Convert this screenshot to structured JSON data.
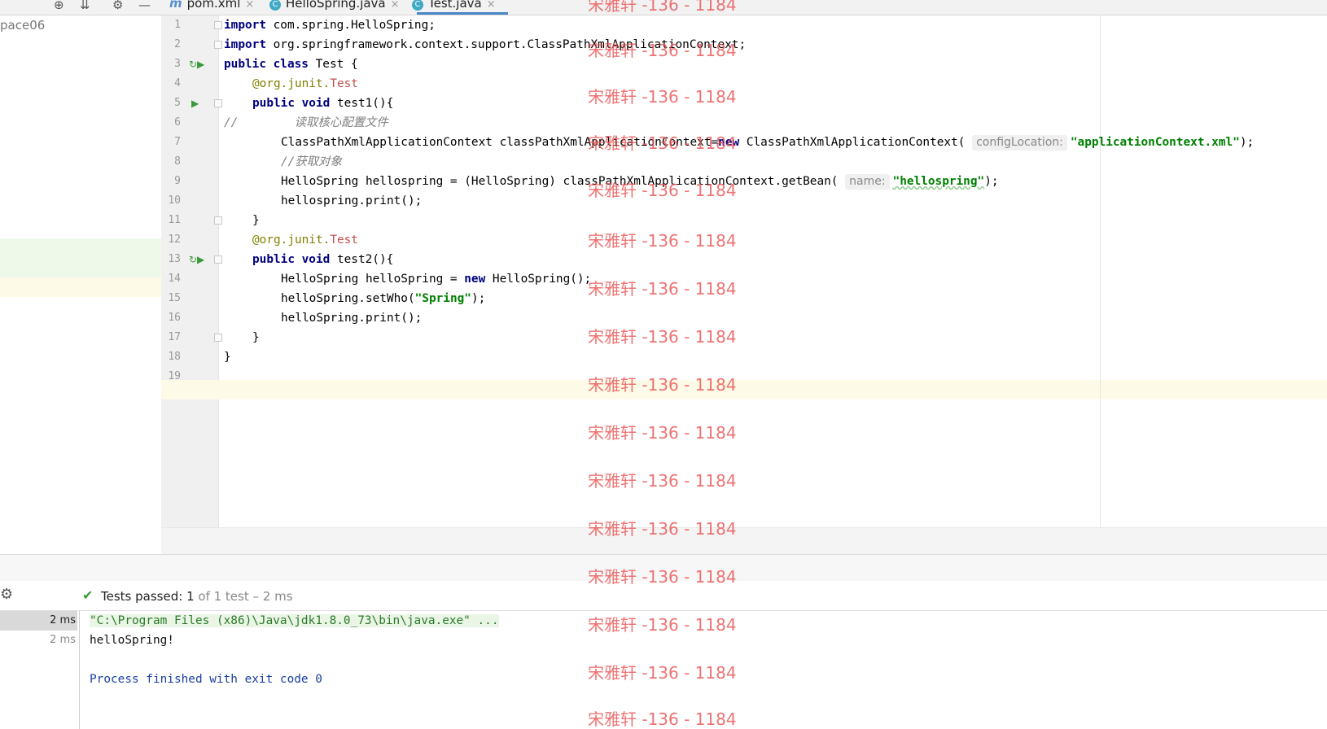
{
  "tabs": [
    {
      "label": "pom.xml",
      "icon": "maven-icon",
      "active": false
    },
    {
      "label": "HelloSpring.java",
      "icon": "class-icon",
      "active": false
    },
    {
      "label": "Test.java",
      "icon": "class-icon",
      "active": true
    }
  ],
  "tab_close_glyph": "×",
  "project": {
    "root_label": "pace06"
  },
  "editor": {
    "line_numbers": [
      "1",
      "2",
      "3",
      "4",
      "5",
      "6",
      "7",
      "8",
      "9",
      "10",
      "11",
      "12",
      "13",
      "14",
      "15",
      "16",
      "17",
      "18",
      "19"
    ],
    "lines": {
      "l1_kw": "import",
      "l1_rest": " com.spring.HelloSpring;",
      "l2_kw": "import",
      "l2_rest": " org.springframework.context.support.ClassPathXmlApplicationContext;",
      "l3_kw": "public class",
      "l3_rest": " Test {",
      "l4_at": "@org.junit.",
      "l4_name": "Test",
      "l5_kw": "public void",
      "l5_rest": " test1(){",
      "l6_slash": "//",
      "l6_comment": "        读取核心配置文件",
      "l7_pre": "ClassPathXmlApplicationContext classPathXmlApplicationContext=",
      "l7_kw": "new",
      "l7_mid": " ClassPathXmlApplicationContext(",
      "l7_hint": "configLocation:",
      "l7_str": "\"applicationContext.xml\"",
      "l7_end": ");",
      "l8_comment": "//获取对象",
      "l9_pre": "HelloSpring hellospring = (HelloSpring) classPathXmlApplicationContext.getBean(",
      "l9_hint": "name:",
      "l9_str": "\"hellospring\"",
      "l9_end": ");",
      "l10": "hellospring.print();",
      "l11": "}",
      "l12_at": "@org.junit.",
      "l12_name": "Test",
      "l13_kw": "public void",
      "l13_rest": " test2(){",
      "l14_pre": "HelloSpring helloSpring = ",
      "l14_kw": "new",
      "l14_rest": " HelloSpring();",
      "l15_pre": "helloSpring.setWho(",
      "l15_str": "\"Spring\"",
      "l15_end": ");",
      "l16": "helloSpring.print();",
      "l17": "}",
      "l18": "}"
    }
  },
  "run": {
    "status_prefix": "Tests passed:",
    "status_count": "1",
    "status_suffix": "of 1 test – 2 ms",
    "tree_rows": [
      {
        "duration": "2 ms",
        "selected": true
      },
      {
        "duration": "2 ms",
        "selected": false
      }
    ],
    "console": {
      "command": "\"C:\\Program Files (x86)\\Java\\jdk1.8.0_73\\bin\\java.exe\" ...",
      "output": "helloSpring!",
      "exit": "Process finished with exit code 0"
    }
  },
  "watermark": "宋雅轩 -136 - 1184",
  "colors": {
    "keyword": "#000080",
    "string": "#008000",
    "annotation": "#808000",
    "comment": "#808080",
    "pass_green": "#3a9a3a",
    "console_blue": "#1a3fa0",
    "watermark_red": "#eb5050"
  }
}
